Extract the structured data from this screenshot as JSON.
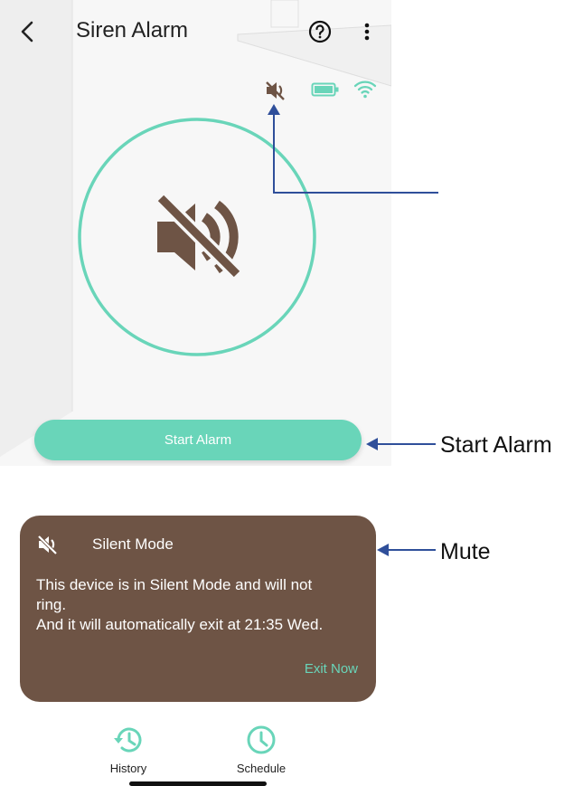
{
  "header": {
    "title": "Siren Alarm",
    "icons": [
      "back-chevron-icon",
      "help-icon",
      "more-vertical-icon"
    ]
  },
  "status_bar": {
    "icons": [
      "mute-status-icon",
      "battery-icon",
      "wifi-icon"
    ]
  },
  "main": {
    "center_icon": "mute-icon",
    "start_button_label": "Start Alarm"
  },
  "annotations": {
    "start_alarm": "Start Alarm",
    "mute": "Mute"
  },
  "silent_card": {
    "title": "Silent Mode",
    "message": "This device is in Silent Mode and will not\nring.\nAnd it will automatically exit at 21:35 Wed.",
    "exit_label": "Exit Now"
  },
  "bottom_nav": {
    "history_label": "History",
    "schedule_label": "Schedule"
  },
  "colors": {
    "accent": "#69d5b9",
    "mute_brown": "#6e5445",
    "card_bg": "#6e5445",
    "annotation_arrow": "#2f4f9a"
  }
}
